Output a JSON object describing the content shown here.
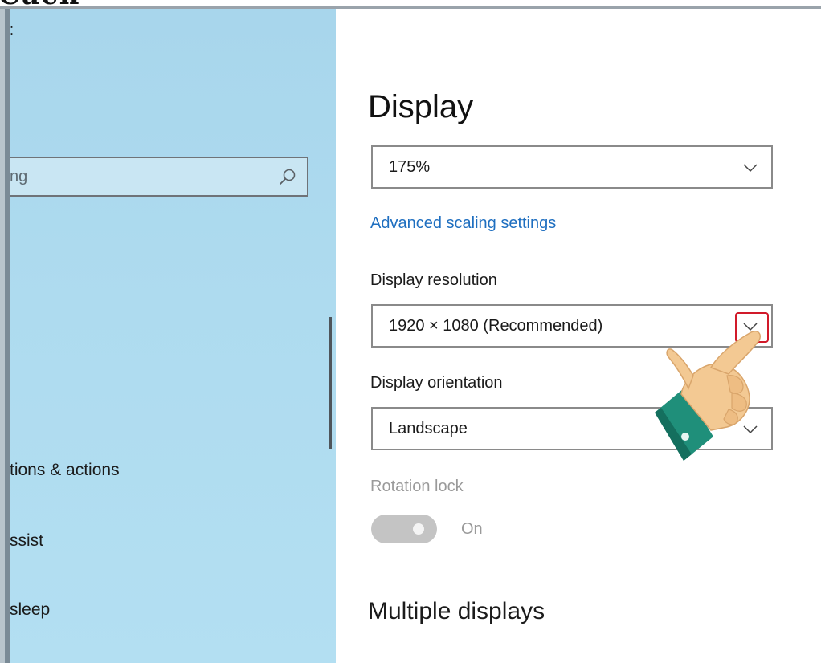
{
  "top_heading": "Cách",
  "sidebar": {
    "marker": ":",
    "search": {
      "placeholder": "ng"
    },
    "items": [
      {
        "label": "tions & actions"
      },
      {
        "label": "ssist"
      },
      {
        "label": "sleep"
      }
    ],
    "item_prefixes": [
      "",
      "ſ",
      "ı"
    ]
  },
  "main": {
    "title": "Display",
    "scale": {
      "value": "175%"
    },
    "advanced_link": "Advanced scaling settings",
    "resolution": {
      "label": "Display resolution",
      "value": "1920 × 1080 (Recommended)"
    },
    "orientation": {
      "label": "Display orientation",
      "value": "Landscape"
    },
    "rotation_lock": {
      "label": "Rotation lock",
      "state": "On"
    },
    "multiple_displays": "Multiple displays"
  },
  "colors": {
    "sidebar_bg": "#aedbef",
    "link": "#1f6fc0",
    "highlight": "#d11a2a",
    "toggle_off": "#c4c4c4"
  }
}
